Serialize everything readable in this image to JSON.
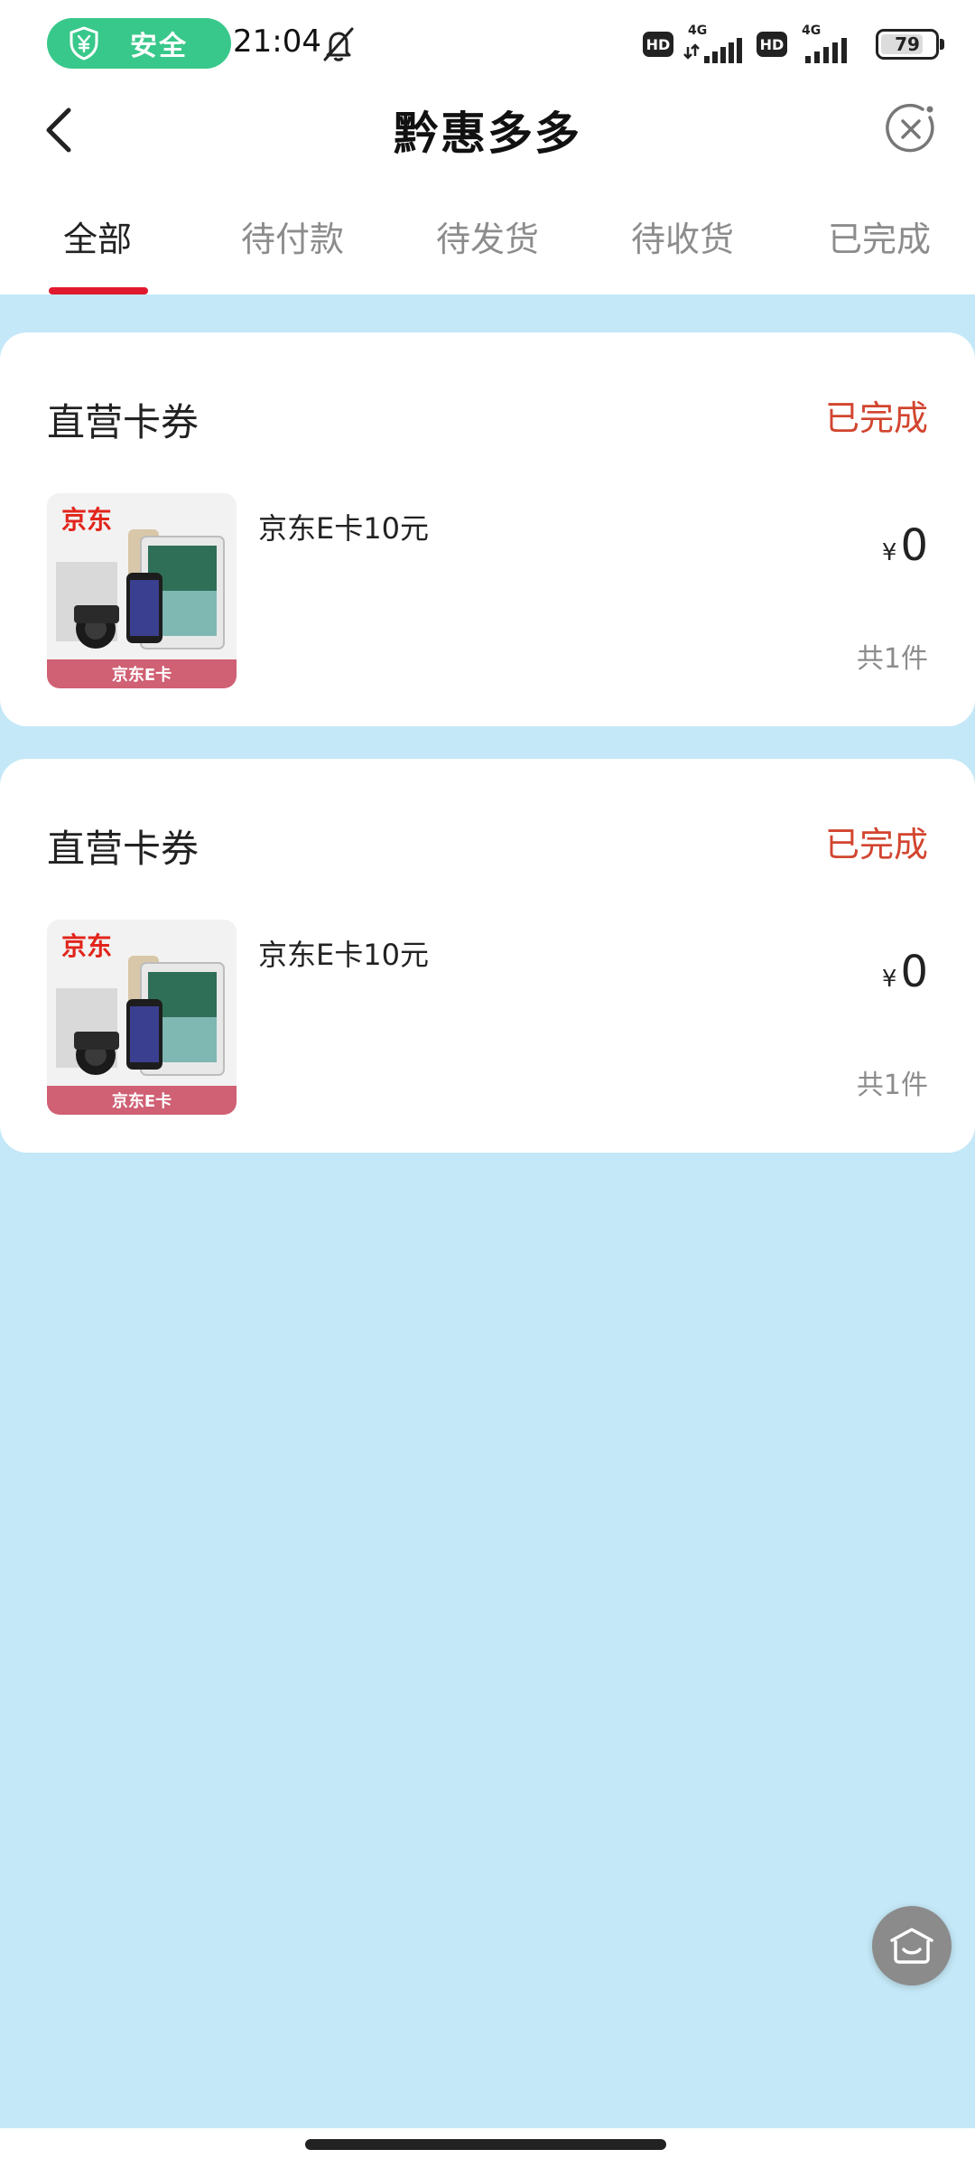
{
  "status_bar": {
    "safe_label": "安全",
    "time": "21:04",
    "hd_label": "HD",
    "network_label": "4G",
    "battery_level": "79",
    "battery_fraction": 0.79
  },
  "header": {
    "title": "黔惠多多"
  },
  "tabs": [
    {
      "label": "全部",
      "active": true
    },
    {
      "label": "待付款",
      "active": false
    },
    {
      "label": "待发货",
      "active": false
    },
    {
      "label": "待收货",
      "active": false
    },
    {
      "label": "已完成",
      "active": false
    }
  ],
  "orders": [
    {
      "shop": "直营卡券",
      "status": "已完成",
      "thumb_logo": "京东",
      "thumb_band": "京东E卡",
      "product": "京东E卡10元",
      "currency": "¥",
      "price": "0",
      "quantity": "共1件"
    },
    {
      "shop": "直营卡券",
      "status": "已完成",
      "thumb_logo": "京东",
      "thumb_band": "京东E卡",
      "product": "京东E卡10元",
      "currency": "¥",
      "price": "0",
      "quantity": "共1件"
    }
  ],
  "icons": {
    "back": "chevron-left-icon",
    "close": "close-circle-icon",
    "safe": "shield-yuan-icon",
    "mute": "bell-off-icon",
    "float": "service-icon"
  },
  "colors": {
    "accent_red": "#e0192e",
    "status_red": "#d2452f",
    "safe_green": "#39c88b",
    "page_background": "#c4e8f7"
  }
}
